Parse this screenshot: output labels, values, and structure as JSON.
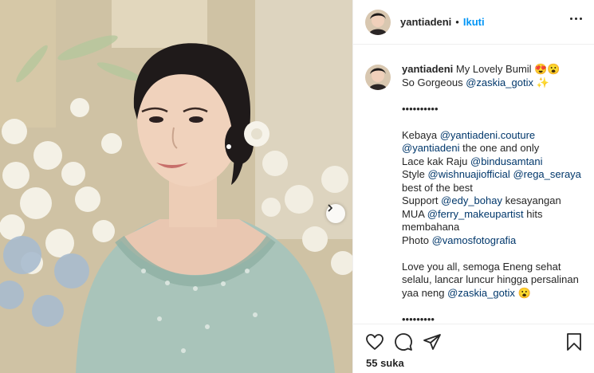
{
  "post": {
    "username": "yantiadeni",
    "follow_label": "Ikuti",
    "header_separator": "•",
    "caption": {
      "line1_text": "My Lovely Bumil 😍😮",
      "line2_prefix": "So Gorgeous ",
      "line2_mention": "@zaskia_gotix",
      "line2_suffix": " ✨",
      "dots": "••••••••••",
      "kebaya_prefix": "Kebaya ",
      "kebaya_mention": "@yantiadeni.couture",
      "one_mention": "@yantiadeni",
      "one_suffix": " the one and only",
      "lace_prefix": "Lace kak Raju ",
      "lace_mention": "@bindusamtani",
      "style_prefix": "Style ",
      "style_mention1": "@wishnuajiofficial",
      "style_mention2": "@rega_seraya",
      "best_text": "best of the best",
      "support_prefix": "Support ",
      "support_mention": "@edy_bohay",
      "support_suffix": " kesayangan",
      "mua_prefix": "MUA ",
      "mua_mention": "@ferry_makeupartist",
      "mua_suffix": " hits",
      "membahana_text": "membahana",
      "photo_prefix": "Photo ",
      "photo_mention": "@vamosfotografia",
      "love_line1": "Love you all, semoga Eneng sehat",
      "love_line2": "selalu, lancar luncur hingga persalinan",
      "love_line3_prefix": "yaa neng ",
      "love_line3_mention": "@zaskia_gotix",
      "love_line3_suffix": " 😮",
      "dots_bottom": "•••••••••"
    },
    "likes_label": "55 suka"
  },
  "icons": {
    "more": "more-options-icon",
    "like": "heart-icon",
    "comment": "comment-icon",
    "share": "share-icon",
    "save": "bookmark-icon",
    "next": "chevron-right-icon"
  },
  "colors": {
    "link": "#00376b",
    "follow": "#0095f6",
    "text": "#262626",
    "border": "#efefef"
  }
}
